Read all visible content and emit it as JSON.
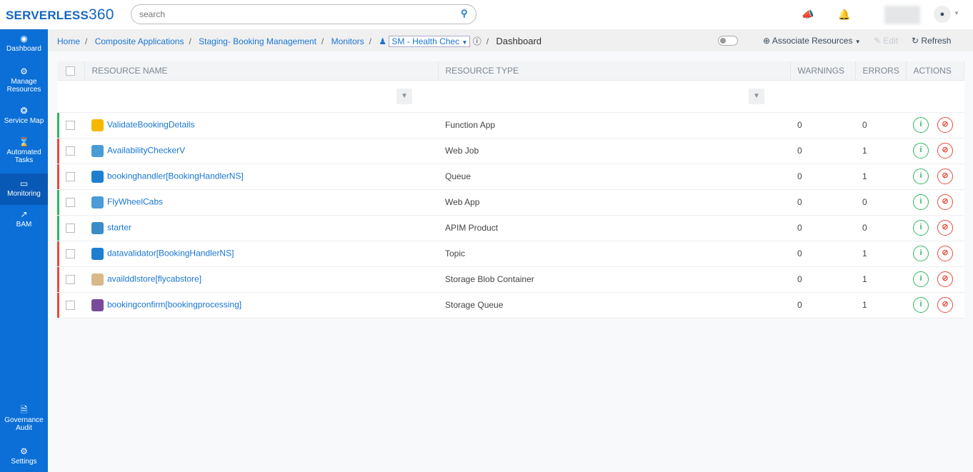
{
  "app": {
    "logo": "SERVERLESS",
    "logo_num": "360"
  },
  "search": {
    "placeholder": "search"
  },
  "sidebar": {
    "items": [
      {
        "label": "Dashboard",
        "icon": "gauge-icon"
      },
      {
        "label": "Manage Resources",
        "icon": "gear-icon"
      },
      {
        "label": "Service Map",
        "icon": "network-icon"
      },
      {
        "label": "Automated Tasks",
        "icon": "hourglass-icon"
      },
      {
        "label": "Monitoring",
        "icon": "laptop-icon"
      },
      {
        "label": "BAM",
        "icon": "chart-icon"
      },
      {
        "label": "Governance Audit",
        "icon": "documents-icon"
      },
      {
        "label": "Settings",
        "icon": "gear-icon"
      }
    ]
  },
  "breadcrumb": {
    "items": [
      "Home",
      "Composite Applications",
      "Staging- Booking Management",
      "Monitors"
    ],
    "monitor": "SM - Health Chec",
    "current": "Dashboard"
  },
  "toolbar": {
    "associate": "Associate Resources",
    "edit": "Edit",
    "refresh": "Refresh"
  },
  "table": {
    "headers": [
      "RESOURCE NAME",
      "RESOURCE TYPE",
      "WARNINGS",
      "ERRORS",
      "ACTIONS"
    ],
    "rows": [
      {
        "name": "ValidateBookingDetails",
        "type": "Function App",
        "warnings": "0",
        "errors": "0",
        "status": "ok"
      },
      {
        "name": "AvailabilityCheckerV",
        "type": "Web Job",
        "warnings": "0",
        "errors": "1",
        "status": "bad"
      },
      {
        "name": "bookinghandler[BookingHandlerNS]",
        "type": "Queue",
        "warnings": "0",
        "errors": "1",
        "status": "bad"
      },
      {
        "name": "FlyWheelCabs",
        "type": "Web App",
        "warnings": "0",
        "errors": "0",
        "status": "ok"
      },
      {
        "name": "starter",
        "type": "APIM Product",
        "warnings": "0",
        "errors": "0",
        "status": "ok"
      },
      {
        "name": "datavalidator[BookingHandlerNS]",
        "type": "Topic",
        "warnings": "0",
        "errors": "1",
        "status": "bad"
      },
      {
        "name": "availddlstore[flycabstore]",
        "type": "Storage Blob Container",
        "warnings": "0",
        "errors": "1",
        "status": "bad"
      },
      {
        "name": "bookingconfirm[bookingprocessing]",
        "type": "Storage Queue",
        "warnings": "0",
        "errors": "1",
        "status": "bad"
      }
    ]
  },
  "colors": {
    "sidebar": "#0b6fd7",
    "ok": "#2eb85c",
    "error": "#e74c3c"
  }
}
